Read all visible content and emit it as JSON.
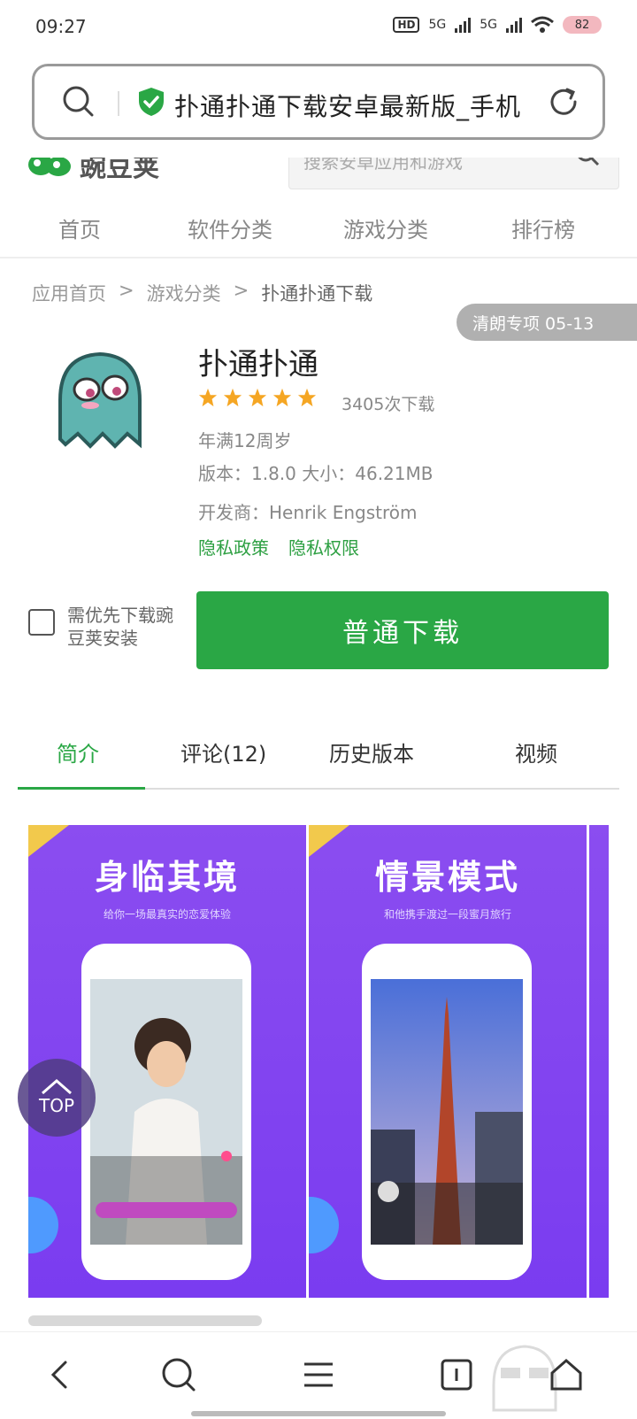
{
  "status_bar": {
    "time": "09:27",
    "network_1": "5G",
    "network_2": "5G",
    "hd_label": "HD",
    "battery": "82"
  },
  "address_bar": {
    "title": "扑通扑通下载安卓最新版_手机"
  },
  "site": {
    "name": "豌豆荚",
    "search_placeholder": "搜索安卓应用和游戏"
  },
  "nav": {
    "items": [
      "首页",
      "软件分类",
      "游戏分类",
      "排行榜"
    ]
  },
  "breadcrumb": {
    "home": "应用首页",
    "sep": ">",
    "category": "游戏分类",
    "current": "扑通扑通下载"
  },
  "badge": {
    "text": "清朗专项 05-13"
  },
  "app": {
    "name": "扑通扑通",
    "rating_stars": 5,
    "downloads": "3405次下载",
    "age": "年满12周岁",
    "version_size": "版本：1.8.0  大小：46.21MB",
    "developer": "开发商：Henrik Engström",
    "privacy_policy": "隐私政策",
    "privacy_permissions": "隐私权限"
  },
  "download": {
    "priority_label": "需优先下载豌豆荚安装",
    "button_label": "普通下载"
  },
  "tabs": {
    "items": [
      "简介",
      "评论(12)",
      "历史版本",
      "视频"
    ],
    "active": "简介"
  },
  "screenshots": [
    {
      "title": "身临其境",
      "subtitle": "给你一场最真实的恋爱体验"
    },
    {
      "title": "情景模式",
      "subtitle": "和他携手渡过一段蜜月旅行"
    }
  ],
  "top_button": {
    "label": "TOP"
  },
  "colors": {
    "accent_green": "#2aa745",
    "shot_purple": "#8b4df0",
    "badge_gray": "#b0b0b0"
  }
}
